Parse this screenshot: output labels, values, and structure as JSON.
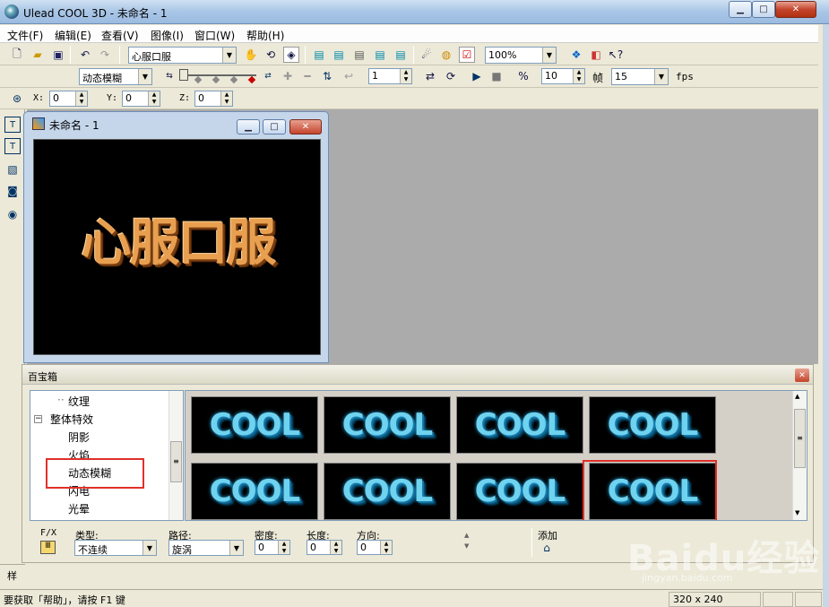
{
  "window": {
    "title": "Ulead COOL 3D - 未命名 - 1",
    "minimize": "0",
    "maximize": "1",
    "close": "r"
  },
  "menu": [
    "文件(F)",
    "编辑(E)",
    "查看(V)",
    "图像(I)",
    "窗口(W)",
    "帮助(H)"
  ],
  "toolbar": {
    "text_object": "心服口服",
    "zoom": "100%"
  },
  "anim_toolbar": {
    "effect": "动态模糊",
    "frame": "1",
    "frame_count": "10",
    "frame_label": "帧",
    "fps_value": "15",
    "fps_label": "fps"
  },
  "position_toolbar": {
    "x_label": "X:",
    "x": "0",
    "y_label": "Y:",
    "y": "0",
    "z_label": "Z:",
    "z": "0"
  },
  "child_window": {
    "title": "未命名 - 1",
    "canvas_text": "心服口服"
  },
  "palette": {
    "title": "百宝箱",
    "tree": [
      "纹理",
      "整体特效",
      "阴影",
      "火焰",
      "动态模糊",
      "闪电",
      "光晕"
    ],
    "tree_selected": "动态模糊",
    "thumbnail_text": "COOL",
    "fx_label": "F/X",
    "type_label": "类型:",
    "type_value": "不连续",
    "path_label": "路径:",
    "path_value": "旋涡",
    "density_label": "密度:",
    "density_value": "0",
    "length_label": "长度:",
    "length_value": "0",
    "direction_label": "方向:",
    "direction_value": "0",
    "add_label": "添加"
  },
  "status": {
    "help": "要获取「帮助」，请按 F1 键",
    "size": "320 x 240",
    "left_cut": "样"
  },
  "watermark": {
    "brand": "Baidu经验",
    "url": "jingyan.baidu.com"
  }
}
